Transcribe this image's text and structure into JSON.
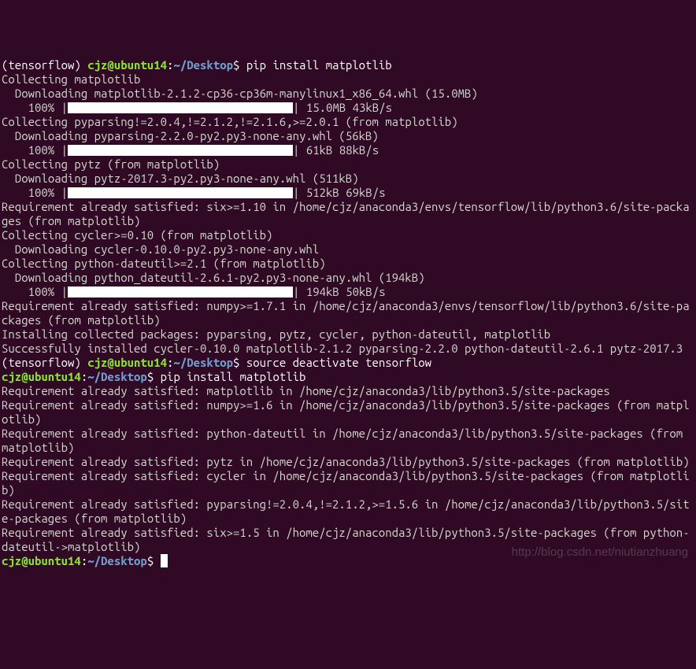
{
  "prompt1": {
    "env": "(tensorflow) ",
    "userhost": "cjz@ubuntu14",
    "colon": ":",
    "path": "~/Desktop",
    "dollar": "$ ",
    "command": "pip install matplotlib"
  },
  "out": {
    "l01": "Collecting matplotlib",
    "l02": "  Downloading matplotlib-2.1.2-cp36-cp36m-manylinux1_x86_64.whl (15.0MB)",
    "l03a": "    100% |",
    "l03b": "| 15.0MB 43kB/s ",
    "l04": "Collecting pyparsing!=2.0.4,!=2.1.2,!=2.1.6,>=2.0.1 (from matplotlib)",
    "l05": "  Downloading pyparsing-2.2.0-py2.py3-none-any.whl (56kB)",
    "l06a": "    100% |",
    "l06b": "| 61kB 88kB/s ",
    "l07": "Collecting pytz (from matplotlib)",
    "l08": "  Downloading pytz-2017.3-py2.py3-none-any.whl (511kB)",
    "l09a": "    100% |",
    "l09b": "| 512kB 69kB/s ",
    "l10": "Requirement already satisfied: six>=1.10 in /home/cjz/anaconda3/envs/tensorflow/lib/python3.6/site-packages (from matplotlib)",
    "l11": "Collecting cycler>=0.10 (from matplotlib)",
    "l12": "  Downloading cycler-0.10.0-py2.py3-none-any.whl",
    "l13": "Collecting python-dateutil>=2.1 (from matplotlib)",
    "l14": "  Downloading python_dateutil-2.6.1-py2.py3-none-any.whl (194kB)",
    "l15a": "    100% |",
    "l15b": "| 194kB 50kB/s ",
    "l16": "Requirement already satisfied: numpy>=1.7.1 in /home/cjz/anaconda3/envs/tensorflow/lib/python3.6/site-packages (from matplotlib)",
    "l17": "Installing collected packages: pyparsing, pytz, cycler, python-dateutil, matplotlib",
    "l18": "Successfully installed cycler-0.10.0 matplotlib-2.1.2 pyparsing-2.2.0 python-dateutil-2.6.1 pytz-2017.3"
  },
  "prompt2": {
    "env": "(tensorflow) ",
    "userhost": "cjz@ubuntu14",
    "colon": ":",
    "path": "~/Desktop",
    "dollar": "$ ",
    "command": "source deactivate tensorflow"
  },
  "prompt3": {
    "userhost": "cjz@ubuntu14",
    "colon": ":",
    "path": "~/Desktop",
    "dollar": "$ ",
    "command": "pip install matplotlib"
  },
  "out2": {
    "l01": "Requirement already satisfied: matplotlib in /home/cjz/anaconda3/lib/python3.5/site-packages",
    "l02": "Requirement already satisfied: numpy>=1.6 in /home/cjz/anaconda3/lib/python3.5/site-packages (from matplotlib)",
    "l03": "Requirement already satisfied: python-dateutil in /home/cjz/anaconda3/lib/python3.5/site-packages (from matplotlib)",
    "l04": "Requirement already satisfied: pytz in /home/cjz/anaconda3/lib/python3.5/site-packages (from matplotlib)",
    "l05": "Requirement already satisfied: cycler in /home/cjz/anaconda3/lib/python3.5/site-packages (from matplotlib)",
    "l06": "Requirement already satisfied: pyparsing!=2.0.4,!=2.1.2,>=1.5.6 in /home/cjz/anaconda3/lib/python3.5/site-packages (from matplotlib)",
    "l07": "Requirement already satisfied: six>=1.5 in /home/cjz/anaconda3/lib/python3.5/site-packages (from python-dateutil->matplotlib)"
  },
  "prompt4": {
    "userhost": "cjz@ubuntu14",
    "colon": ":",
    "path": "~/Desktop",
    "dollar": "$ "
  },
  "watermark": "http://blog.csdn.net/niutianzhuang"
}
